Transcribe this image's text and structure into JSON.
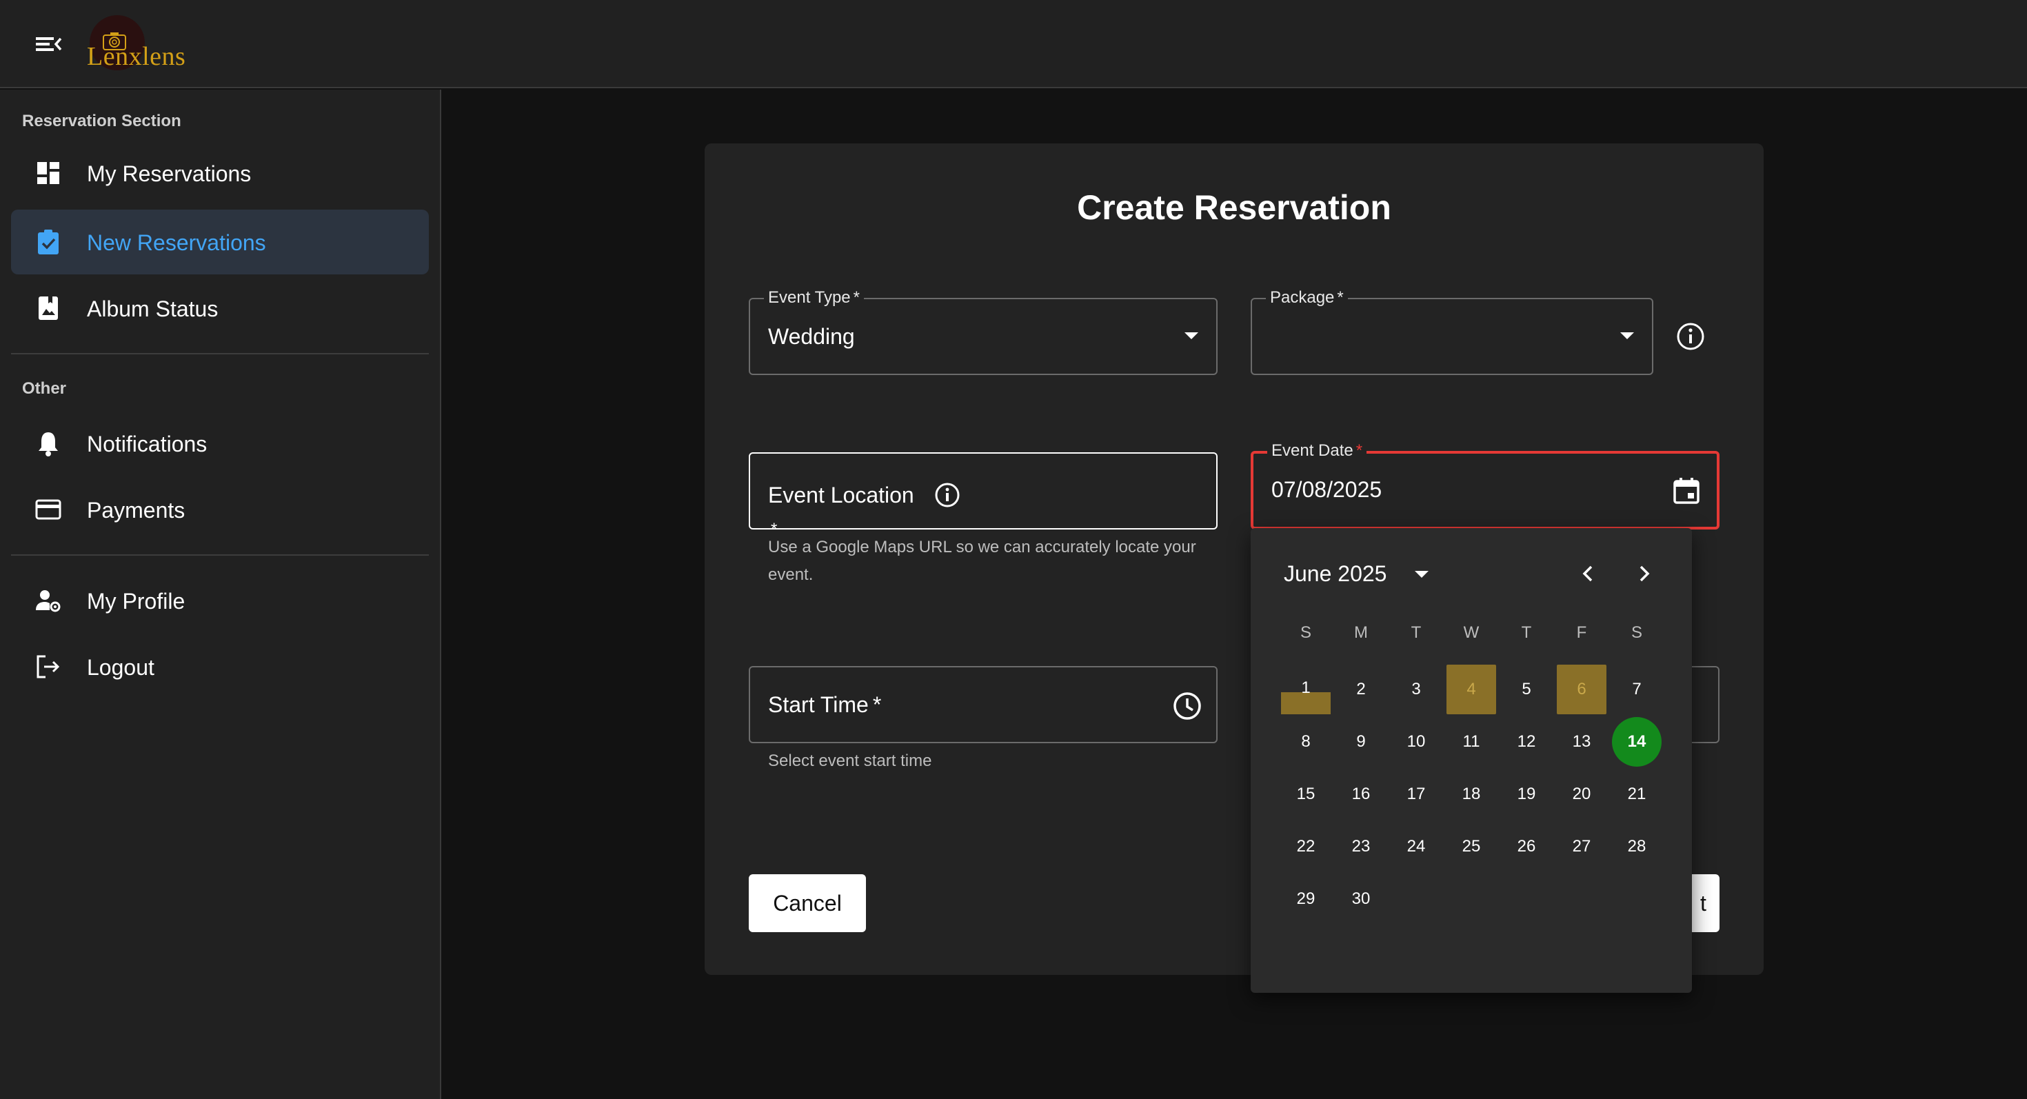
{
  "app": {
    "logo_text": "Lenxlens"
  },
  "sidebar": {
    "section1_label": "Reservation Section",
    "section2_label": "Other",
    "items": [
      {
        "label": "My Reservations",
        "icon": "dashboard-icon"
      },
      {
        "label": "New Reservations",
        "icon": "assignment-check-icon",
        "active": true
      },
      {
        "label": "Album Status",
        "icon": "photo-album-icon"
      },
      {
        "label": "Notifications",
        "icon": "bell-icon"
      },
      {
        "label": "Payments",
        "icon": "credit-card-icon"
      },
      {
        "label": "My Profile",
        "icon": "user-settings-icon"
      },
      {
        "label": "Logout",
        "icon": "logout-icon"
      }
    ]
  },
  "form": {
    "title": "Create Reservation",
    "event_type": {
      "label": "Event Type",
      "required_mark": "*",
      "value": "Wedding"
    },
    "package": {
      "label": "Package",
      "required_mark": "*",
      "value": ""
    },
    "event_location": {
      "label": "Event Location",
      "required_mark": "*",
      "helper": "Use a Google Maps URL so we can accurately locate your event."
    },
    "event_date": {
      "label": "Event Date",
      "required_mark": "*",
      "value": "07/08/2025"
    },
    "start_time": {
      "label": "Start Time",
      "required_mark": "*",
      "helper": "Select event start time"
    },
    "cancel_label": "Cancel",
    "submit_label_visible": "t"
  },
  "calendar": {
    "month_label": "June 2025",
    "weekdays": [
      "S",
      "M",
      "T",
      "W",
      "T",
      "F",
      "S"
    ],
    "days": [
      "1",
      "2",
      "3",
      "4",
      "5",
      "6",
      "7",
      "8",
      "9",
      "10",
      "11",
      "12",
      "13",
      "14",
      "15",
      "16",
      "17",
      "18",
      "19",
      "20",
      "21",
      "22",
      "23",
      "24",
      "25",
      "26",
      "27",
      "28",
      "29",
      "30"
    ],
    "highlighted_days": [
      "4",
      "6"
    ],
    "today": "14",
    "colors": {
      "highlight": "#8a7028",
      "today": "#138a1c",
      "error": "#e53935",
      "accent": "#42a5f5"
    }
  }
}
